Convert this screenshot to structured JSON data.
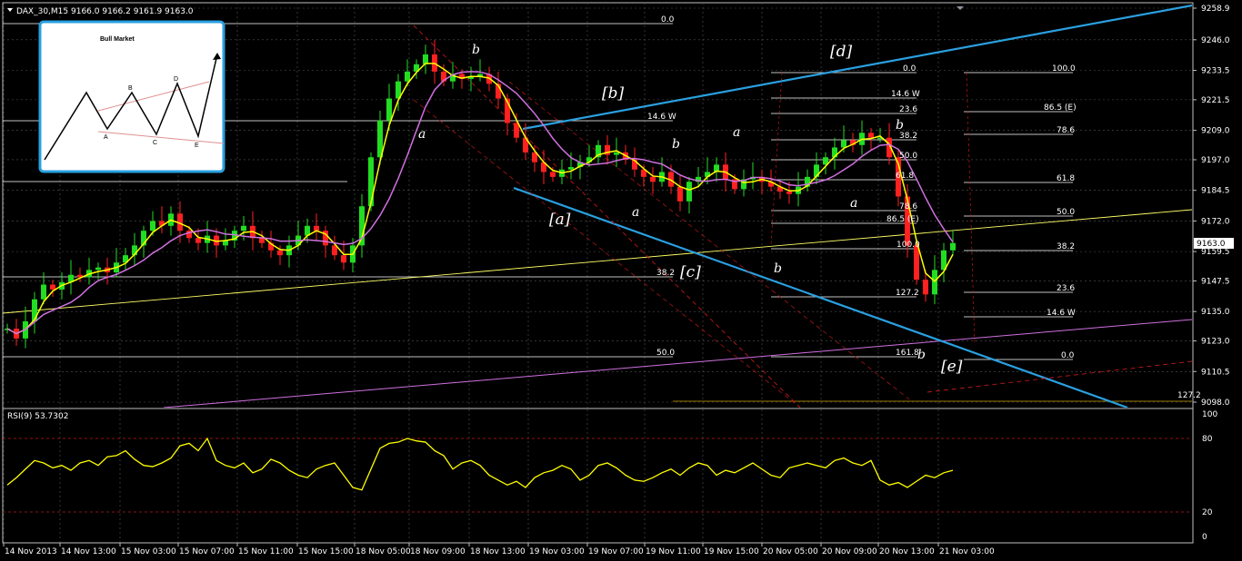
{
  "header": {
    "symbol_line": "DAX_30,M15  9166.0 9166.2 9161.9 9163.0",
    "rsi_label": "RSI(9) 53.7302"
  },
  "inset": {
    "title": "Bull Market",
    "points": [
      "A",
      "B",
      "C",
      "D",
      "E"
    ]
  },
  "chart_data": {
    "type": "line",
    "price_axis": {
      "ticks": [
        "9258.9",
        "9246.0",
        "9233.5",
        "9221.5",
        "9209.0",
        "9197.0",
        "9184.5",
        "9172.0",
        "9159.5",
        "9147.5",
        "9135.0",
        "9123.0",
        "9110.5",
        "9098.0"
      ],
      "current_price": "9163.0"
    },
    "rsi_axis": {
      "ticks": [
        "100",
        "80",
        "20",
        "0"
      ]
    },
    "time_axis": [
      "14 Nov 2013",
      "14 Nov 13:00",
      "15 Nov 03:00",
      "15 Nov 07:00",
      "15 Nov 11:00",
      "15 Nov 15:00",
      "18 Nov 05:00",
      "18 Nov 09:00",
      "18 Nov 13:00",
      "19 Nov 03:00",
      "19 Nov 07:00",
      "19 Nov 11:00",
      "19 Nov 15:00",
      "20 Nov 05:00",
      "20 Nov 09:00",
      "20 Nov 13:00",
      "21 Nov 03:00"
    ],
    "fib_levels_left": [
      "0.0",
      "14.6 W",
      "38.2",
      "50.0"
    ],
    "fib_levels_mid": [
      "0.0",
      "14.6 W",
      "23.6",
      "38.2",
      "50.0",
      "61.8",
      "78.6",
      "86.5 (E)",
      "100.0",
      "127.2",
      "161.8"
    ],
    "fib_levels_right": [
      "100.0",
      "86.5 (E)",
      "78.6",
      "61.8",
      "50.0",
      "38.2",
      "23.6",
      "14.6 W",
      "0.0"
    ],
    "bottom_label": "127.2",
    "wave_labels": [
      "b",
      "[b]",
      "a",
      "[a]",
      "a",
      "b",
      "[c]",
      "a",
      "b",
      "b",
      "[d]",
      "a",
      "b",
      "[e]"
    ],
    "close": [
      9128,
      9124,
      9131,
      9140,
      9146,
      9144,
      9147,
      9150,
      9149,
      9152,
      9153,
      9151,
      9155,
      9158,
      9162,
      9168,
      9172,
      9170,
      9175,
      9168,
      9165,
      9163,
      9166,
      9162,
      9164,
      9168,
      9170,
      9165,
      9163,
      9160,
      9158,
      9162,
      9166,
      9170,
      9168,
      9162,
      9158,
      9155,
      9162,
      9178,
      9198,
      9213,
      9222,
      9229,
      9233,
      9236,
      9240,
      9233,
      9229,
      9232,
      9230,
      9231,
      9232,
      9228,
      9222,
      9212,
      9206,
      9200,
      9196,
      9192,
      9190,
      9193,
      9194,
      9196,
      9198,
      9203,
      9199,
      9200,
      9197,
      9193,
      9190,
      9188,
      9192,
      9186,
      9180,
      9188,
      9190,
      9192,
      9195,
      9189,
      9185,
      9189,
      9190,
      9188,
      9186,
      9184,
      9183,
      9186,
      9190,
      9195,
      9198,
      9202,
      9205,
      9203,
      9208,
      9206,
      9206,
      9198,
      9182,
      9162,
      9148,
      9142,
      9152,
      9160,
      9163
    ],
    "rsi": [
      42,
      48,
      55,
      62,
      60,
      56,
      58,
      54,
      60,
      62,
      58,
      65,
      66,
      70,
      63,
      58,
      57,
      60,
      64,
      74,
      76,
      70,
      80,
      62,
      58,
      56,
      60,
      52,
      55,
      63,
      60,
      54,
      50,
      48,
      55,
      58,
      60,
      50,
      40,
      38,
      55,
      72,
      76,
      77,
      80,
      78,
      77,
      70,
      66,
      55,
      60,
      62,
      58,
      50,
      46,
      42,
      45,
      40,
      48,
      52,
      54,
      58,
      55,
      46,
      50,
      58,
      60,
      56,
      50,
      46,
      45,
      48,
      52,
      55,
      50,
      56,
      60,
      58,
      50,
      54,
      52,
      56,
      60,
      55,
      50,
      48,
      56,
      58,
      60,
      58,
      56,
      62,
      64,
      60,
      58,
      62,
      46,
      42,
      44,
      40,
      45,
      50,
      48,
      52,
      54
    ]
  }
}
